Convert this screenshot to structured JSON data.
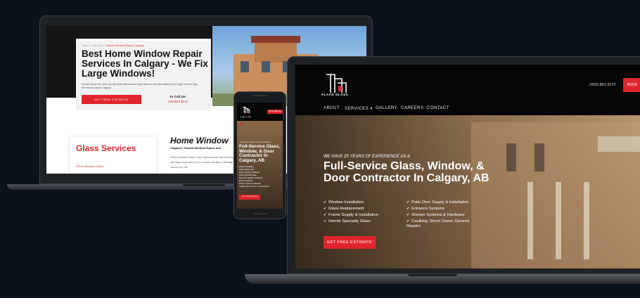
{
  "laptop_back": {
    "breadcrumb": {
      "home": "Home",
      "sep1": ">",
      "services": "Services",
      "sep2": ">",
      "current": "Home Window Repair Calgary"
    },
    "title": "Best Home Window Repair Services In Calgary - We Fix Large Windows!",
    "intro": "KLAAD Glass Ltd. does the big residential window repair jobs no one else wants to do! Large home & high-rise window repair Calgary!",
    "cta_label": "GET FREE ESTIMATE",
    "call_label": "Or Call Us:",
    "phone": "403-891-3172",
    "sidebar_title": "Glass Services",
    "sidebar_link": "Home Window Repair",
    "section_title": "Home Window",
    "section_subtitle": "Calgary's Trusted Window Repair And",
    "section_text": "Home window repair and replacement may become damaged and need to be severe weather, damage caused by oth"
  },
  "laptop_front": {
    "brand": "KLAAD GLASS",
    "phone": "(403) 891-3172",
    "book_label": "BOOK",
    "nav": [
      "ABOUT",
      "SERVICES ▾",
      "GALLERY",
      "CAREERS",
      "CONTACT"
    ],
    "kicker": "WE HAVE 25 YEARS OF EXPERIENCE AS A",
    "title": "Full-Service Glass, Window, & Door Contractor In Calgary, AB",
    "services_left": [
      "Window Installation",
      "Glass Replacement",
      "Frame Supply & Installation",
      "Interior Specialty Glass"
    ],
    "services_right": [
      "Patio Door Supply & Installation",
      "Entrance Systems",
      "Shower Systems & Hardware",
      "Caulking, Storm Doors, General Repairs"
    ],
    "cta_label": "GET FREE ESTIMATE"
  },
  "phone": {
    "brand": "KLAAD GLASS",
    "book_label": "BOOK SERVICE",
    "kicker": "WE HAVE 25 YEARS OF EXPERIENCE AS A",
    "title": "Full-Service Glass, Window, & Door Contractor In Calgary, AB",
    "services": [
      "Window Installation",
      "Glass Replacement",
      "Frame Supply & Installation",
      "Interior Specialty Glass",
      "Patio Door Supply & Installation",
      "Entrance Systems",
      "Shower Systems & Hardware",
      "Caulking, Storm Doors, General Repairs"
    ],
    "cta_label": "GET FREE ESTIMATE"
  },
  "colors": {
    "accent": "#e0262c",
    "background": "#0a131b",
    "dark": "#050505"
  }
}
